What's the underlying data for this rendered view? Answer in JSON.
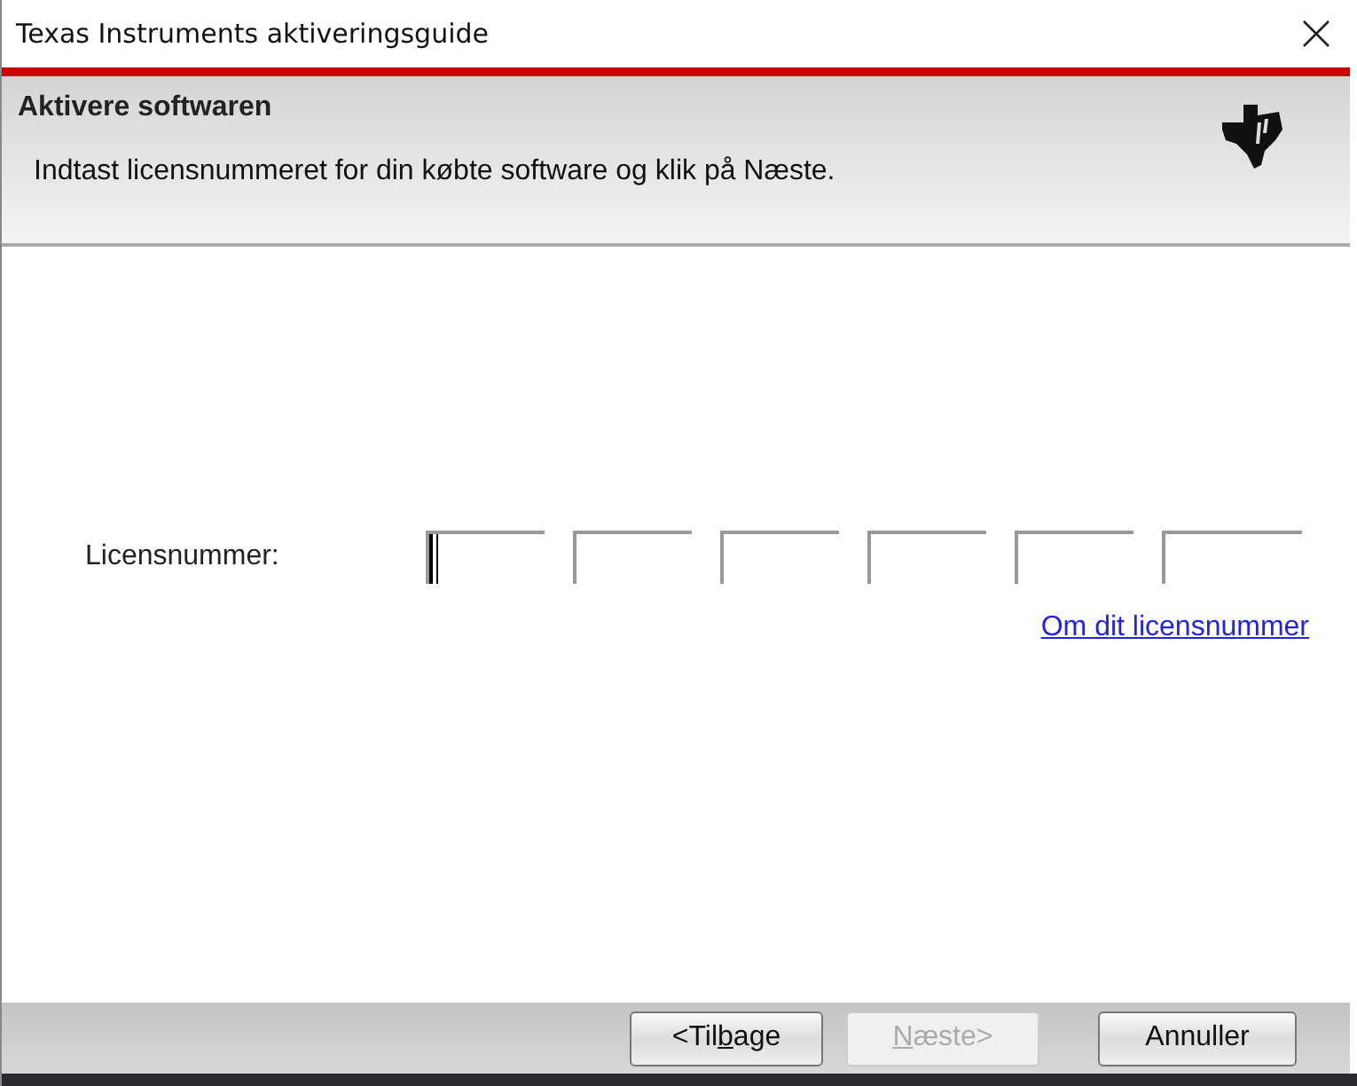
{
  "window": {
    "title": "Texas Instruments aktiveringsguide"
  },
  "header": {
    "title": "Aktivere softwaren",
    "instruction": "Indtast licensnummeret for din købte software og klik på Næste."
  },
  "license": {
    "label": "Licensnummer:",
    "fields": [
      {
        "focused": true
      },
      {
        "focused": false
      },
      {
        "focused": false
      },
      {
        "focused": false
      },
      {
        "focused": false
      },
      {
        "focused": false
      }
    ],
    "link": "Om dit licensnummer"
  },
  "buttons": [
    {
      "label": "<Til",
      "mnemonic": "b",
      "rest": "age",
      "disabled": false
    },
    {
      "mnemonic": "N",
      "rest": "æste>",
      "disabled": true
    },
    {
      "label": "Annuller",
      "disabled": false
    }
  ]
}
